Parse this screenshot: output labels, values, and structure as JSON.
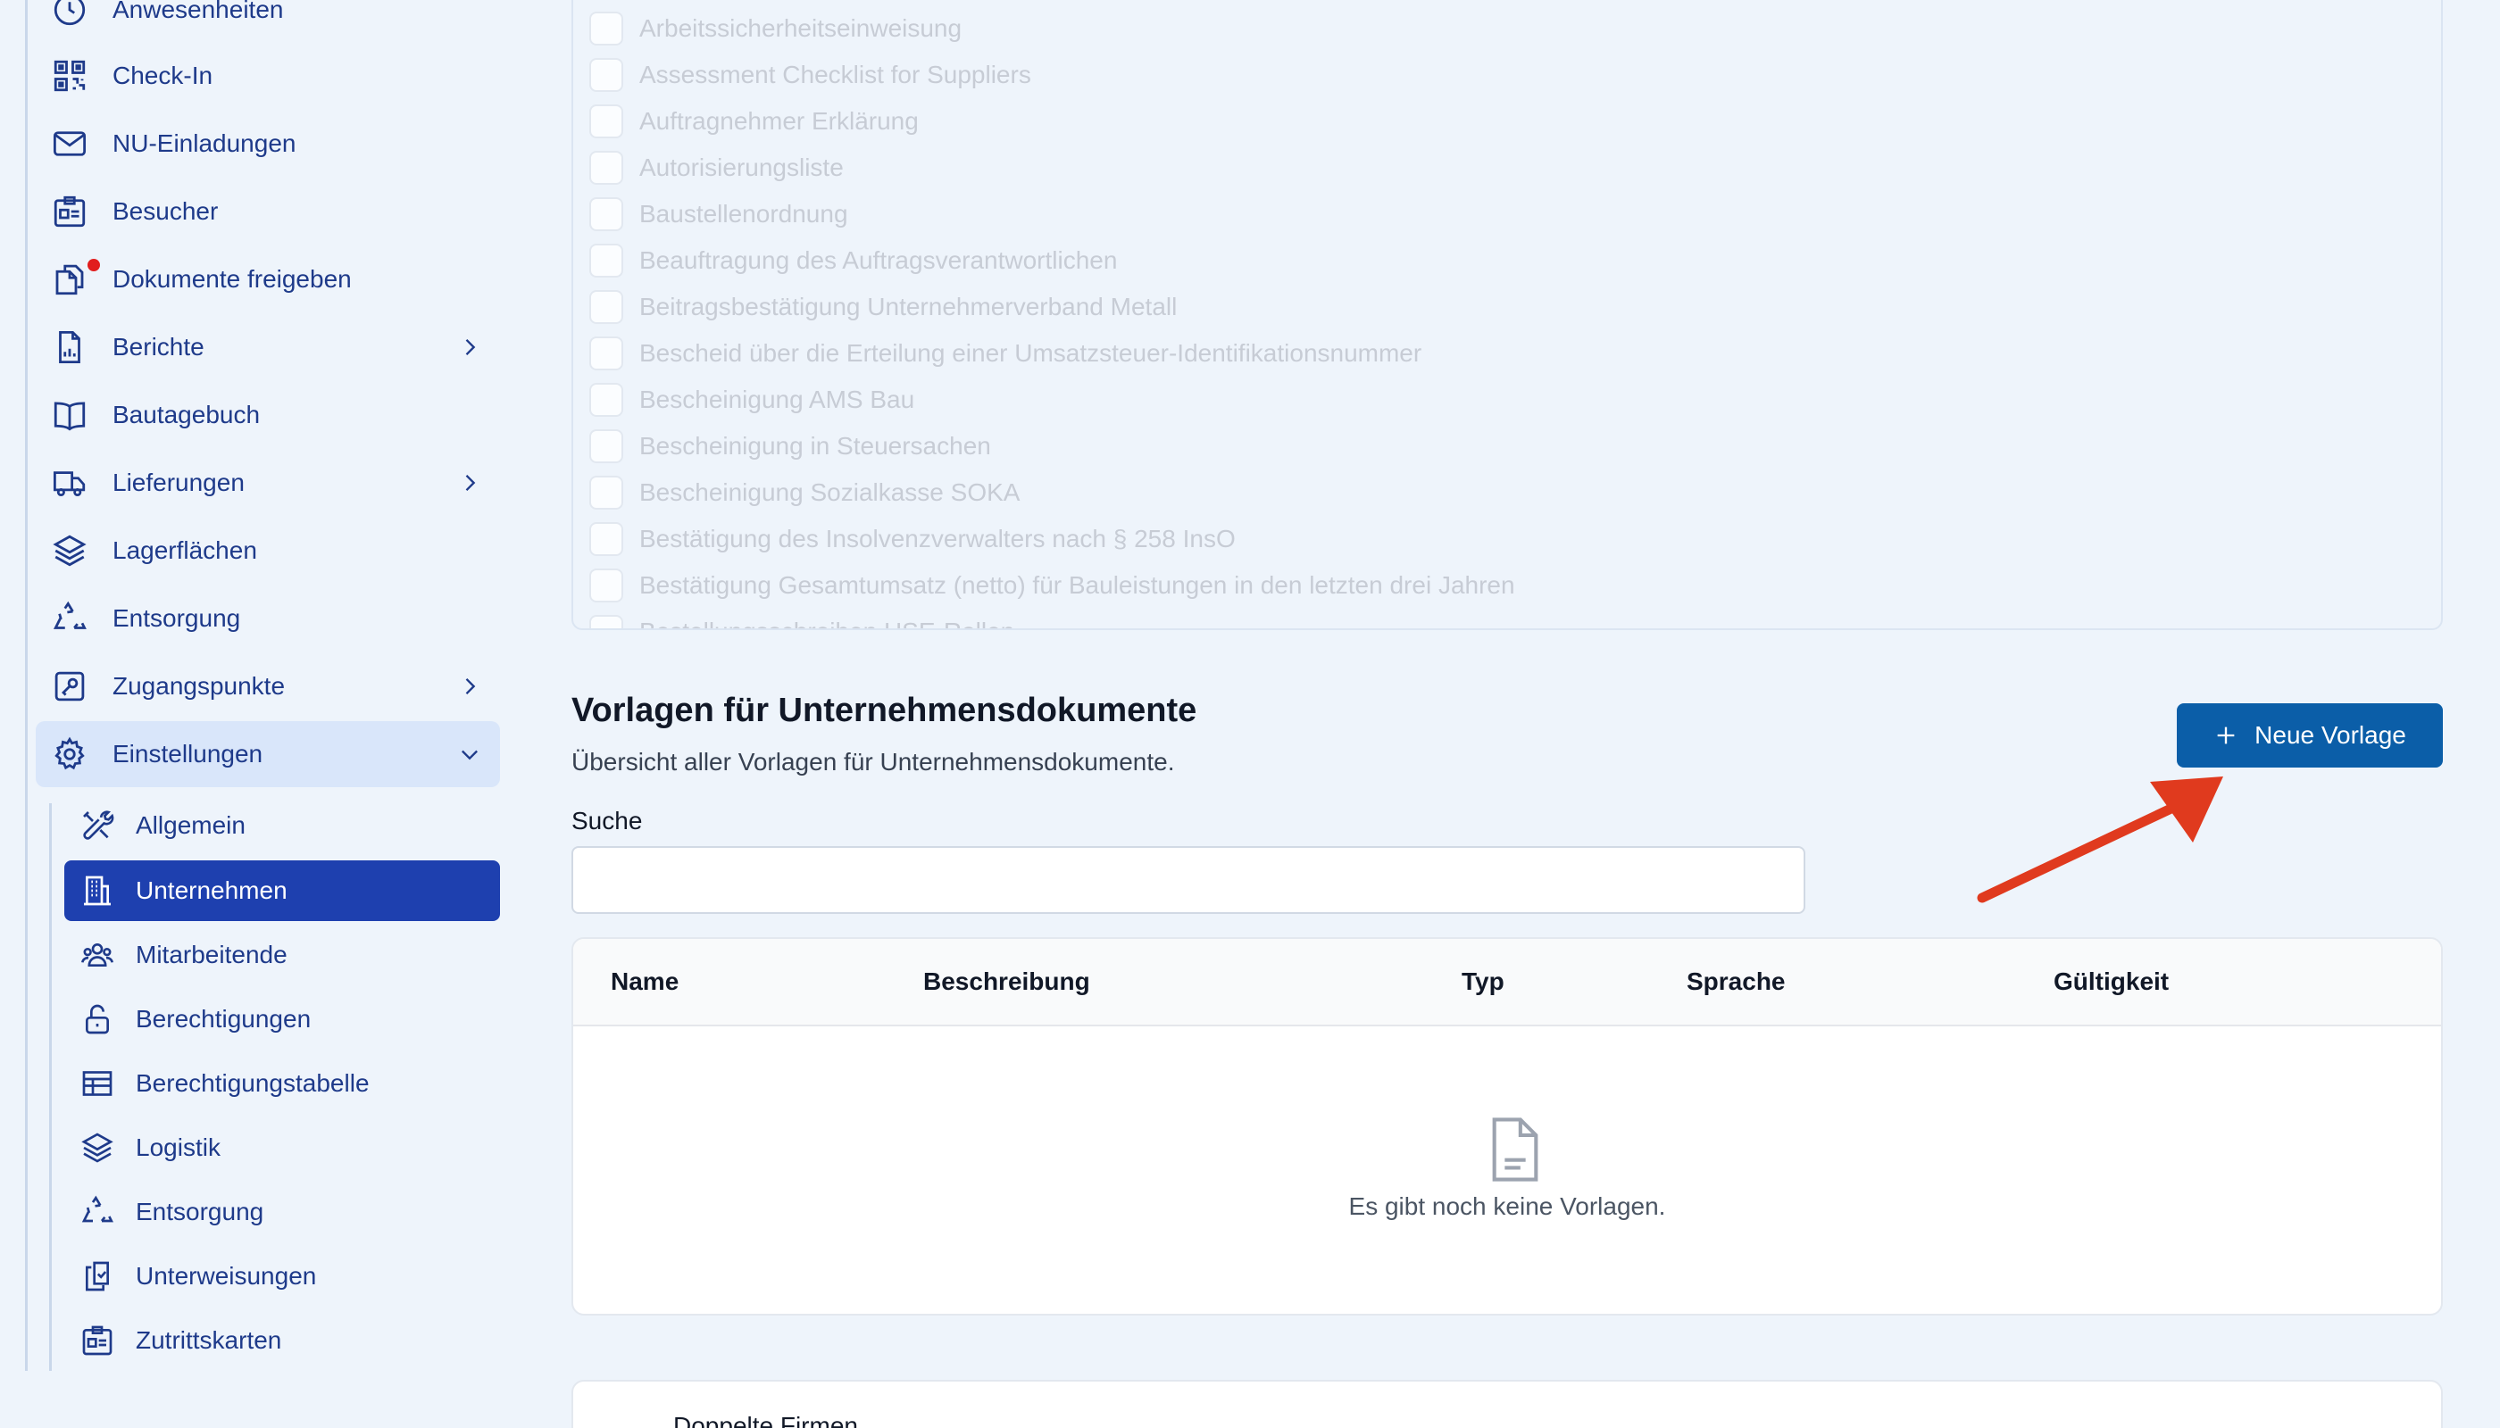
{
  "sidebar": {
    "items": [
      {
        "label": "Anwesenheiten",
        "icon": "clock-icon"
      },
      {
        "label": "Check-In",
        "icon": "qr-code-icon"
      },
      {
        "label": "NU-Einladungen",
        "icon": "envelope-icon"
      },
      {
        "label": "Besucher",
        "icon": "id-card-icon"
      },
      {
        "label": "Dokumente freigeben",
        "icon": "documents-icon",
        "notification": true
      },
      {
        "label": "Berichte",
        "icon": "report-icon"
      },
      {
        "label": "Bautagebuch",
        "icon": "book-icon"
      },
      {
        "label": "Lieferungen",
        "icon": "truck-icon"
      },
      {
        "label": "Lagerflächen",
        "icon": "layers-icon"
      },
      {
        "label": "Entsorgung",
        "icon": "recycle-icon"
      },
      {
        "label": "Zugangspunkte",
        "icon": "key-icon"
      },
      {
        "label": "Einstellungen",
        "icon": "gear-icon"
      }
    ],
    "settings_items": [
      {
        "label": "Allgemein",
        "icon": "tools-icon"
      },
      {
        "label": "Unternehmen",
        "icon": "building-icon"
      },
      {
        "label": "Mitarbeitende",
        "icon": "users-icon"
      },
      {
        "label": "Berechtigungen",
        "icon": "unlock-icon"
      },
      {
        "label": "Berechtigungstabelle",
        "icon": "table-icon"
      },
      {
        "label": "Logistik",
        "icon": "layers-icon"
      },
      {
        "label": "Entsorgung",
        "icon": "recycle-icon"
      },
      {
        "label": "Unterweisungen",
        "icon": "clipboard-check-icon"
      },
      {
        "label": "Zutrittskarten",
        "icon": "id-card-icon"
      }
    ]
  },
  "checklist": {
    "items": [
      "Arbeitssicherheitseinweisung",
      "Assessment Checklist for Suppliers",
      "Auftragnehmer Erklärung",
      "Autorisierungsliste",
      "Baustellenordnung",
      "Beauftragung des Auftragsverantwortlichen",
      "Beitragsbestätigung Unternehmerverband Metall",
      "Bescheid über die Erteilung einer Umsatzsteuer-Identifikationsnummer",
      "Bescheinigung AMS Bau",
      "Bescheinigung in Steuersachen",
      "Bescheinigung Sozialkasse SOKA",
      "Bestätigung des Insolvenzverwalters nach § 258 InsO",
      "Bestätigung Gesamtumsatz (netto) für Bauleistungen in den letzten drei Jahren",
      "Bestellungsschreiben HSE-Rollen"
    ]
  },
  "templates": {
    "title": "Vorlagen für Unternehmensdokumente",
    "subtitle": "Übersicht aller Vorlagen für Unternehmensdokumente.",
    "new_button": "Neue Vorlage",
    "search_label": "Suche",
    "search_value": "",
    "columns": [
      "Name",
      "Beschreibung",
      "Typ",
      "Sprache",
      "Gültigkeit"
    ],
    "empty_text": "Es gibt noch keine Vorlagen."
  },
  "lower_section": {
    "title": "Doppelte Firmen"
  },
  "colors": {
    "accent": "#1e40af",
    "button": "#0b5ea8",
    "nav_text": "#1e3a8a",
    "annotation_arrow": "#e03a1e",
    "notification": "#e11d1d"
  }
}
